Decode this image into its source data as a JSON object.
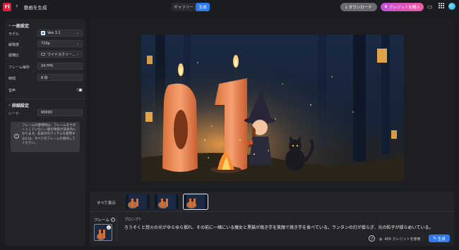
{
  "header": {
    "logo_text": "Fl",
    "back_icon": "back-arrow-icon",
    "title": "動画を生成",
    "tabs": [
      {
        "label": "ギャラリー",
        "active": false
      },
      {
        "label": "生成",
        "active": true
      }
    ],
    "download_label": "ダウンロード",
    "buy_credits_label": "クレジットを購入",
    "accent_color": "#2f7bef"
  },
  "sidebar": {
    "general_section": "一般設定",
    "fields": [
      {
        "label": "モデル",
        "value": "Veo 3.1",
        "icon": "model-logo-icon",
        "dropdown": true
      },
      {
        "label": "解像度",
        "value": "720p",
        "dropdown": true
      },
      {
        "label": "縦横比",
        "value": "ワイドスクリー...",
        "icon": "aspect-ratio-icon",
        "dropdown": true
      },
      {
        "label": "フレーム毎秒",
        "value": "24 FPS",
        "dropdown": false
      },
      {
        "label": "時間",
        "value": "8 秒",
        "dropdown": false
      }
    ],
    "audio_label": "音声",
    "advanced_section": "詳細設定",
    "seed_label": "シード",
    "seed_value": "90690",
    "info_text": "フレームの使用時は、フレームをサポートしていない一部の項目が非表示になります。非表示のアイテムを使用するには、すべてのフレームを削除してください。"
  },
  "bottom": {
    "show_all_label": "すべて表示",
    "frame_label": "フレーム",
    "prompt_label": "プロンプト",
    "prompt_text": "ろうそくと焚火の光がゆらゆら揺れ、その前に一緒にいる魔女と黒猫が焼き芋を笑顔で焼き芋を食べている。ランタンの灯が揺らぎ、光の粒子が揺らめいている。",
    "credit_text": "400 クレジットを使用",
    "generate_label": "生成"
  }
}
